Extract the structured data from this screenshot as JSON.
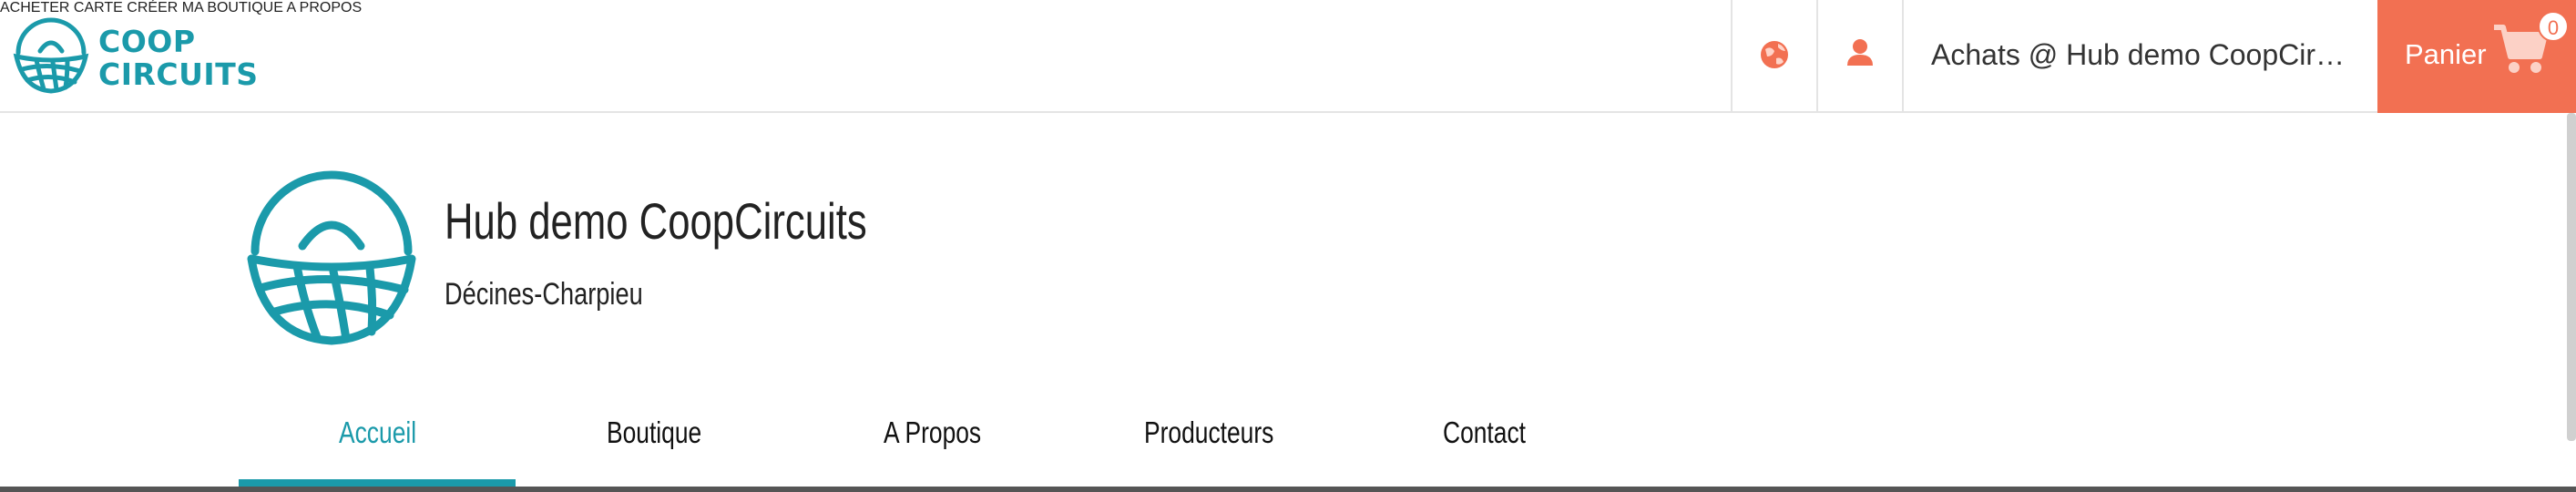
{
  "brand": {
    "line1": "COOP",
    "line2": "CIRCUITS",
    "color": "#1b9aaa"
  },
  "nav": {
    "items": [
      {
        "label": "ACHETER"
      },
      {
        "label": "CARTE"
      },
      {
        "label": "CRÉER MA BOUTIQUE"
      },
      {
        "label": "A PROPOS"
      }
    ],
    "language_icon": "globe-icon",
    "user_icon": "user-icon",
    "hub_selector": "Achats @ Hub demo CoopCircuits",
    "cart": {
      "label": "Panier",
      "count": "0",
      "icon": "shopping-cart-icon",
      "color": "#f27052"
    }
  },
  "hub": {
    "name": "Hub demo CoopCircuits",
    "city": "Décines-Charpieu"
  },
  "tabs": [
    {
      "label": "Accueil",
      "active": true
    },
    {
      "label": "Boutique",
      "active": false
    },
    {
      "label": "A Propos",
      "active": false
    },
    {
      "label": "Producteurs",
      "active": false
    },
    {
      "label": "Contact",
      "active": false
    }
  ]
}
